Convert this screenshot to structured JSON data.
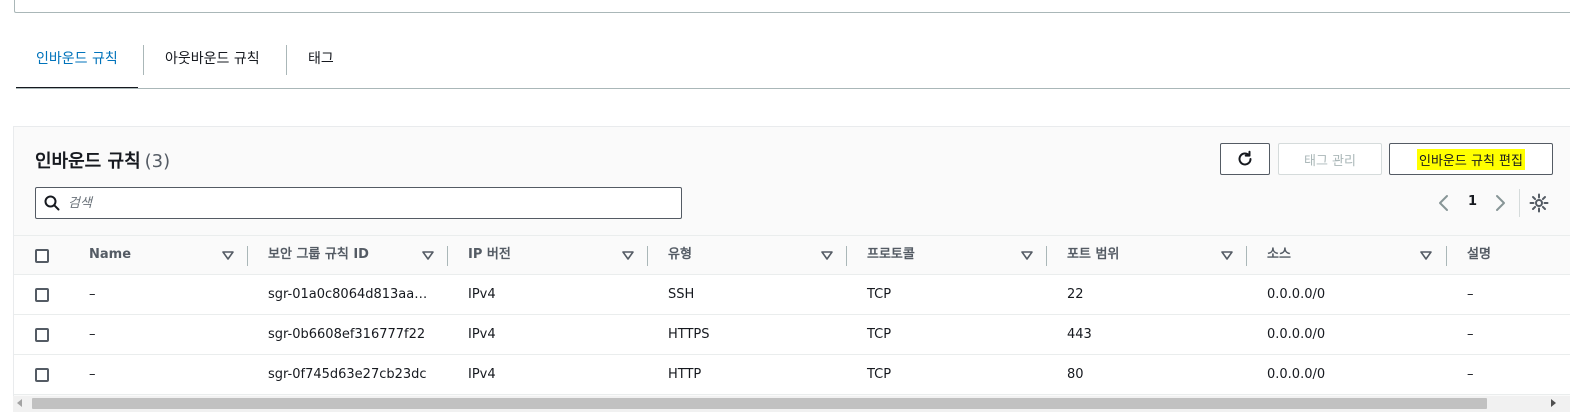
{
  "tabs": [
    {
      "label": "인바운드 규칙",
      "active": true
    },
    {
      "label": "아웃바운드 규칙",
      "active": false
    },
    {
      "label": "태그",
      "active": false
    }
  ],
  "panel": {
    "title": "인바운드 규칙",
    "count": "(3)",
    "buttons": {
      "refresh": "refresh-icon",
      "manage_tags": "태그 관리",
      "edit_inbound": "인바운드 규칙 편집"
    },
    "search": {
      "placeholder": "검색",
      "value": ""
    },
    "pagination": {
      "current_page": "1"
    }
  },
  "table": {
    "columns": [
      "Name",
      "보안 그룹 규칙 ID",
      "IP 버전",
      "유형",
      "프로토콜",
      "포트 범위",
      "소스",
      "설명"
    ],
    "rows": [
      {
        "name": "–",
        "rule_id": "sgr-01a0c8064d813aa…",
        "ip_version": "IPv4",
        "type": "SSH",
        "protocol": "TCP",
        "port_range": "22",
        "source": "0.0.0.0/0",
        "description": "–"
      },
      {
        "name": "–",
        "rule_id": "sgr-0b6608ef316777f22",
        "ip_version": "IPv4",
        "type": "HTTPS",
        "protocol": "TCP",
        "port_range": "443",
        "source": "0.0.0.0/0",
        "description": "–"
      },
      {
        "name": "–",
        "rule_id": "sgr-0f745d63e27cb23dc",
        "ip_version": "IPv4",
        "type": "HTTP",
        "protocol": "TCP",
        "port_range": "80",
        "source": "0.0.0.0/0",
        "description": "–"
      }
    ]
  },
  "colors": {
    "active_tab": "#0073bb",
    "highlight": "#ffff00",
    "border": "#545b64"
  }
}
